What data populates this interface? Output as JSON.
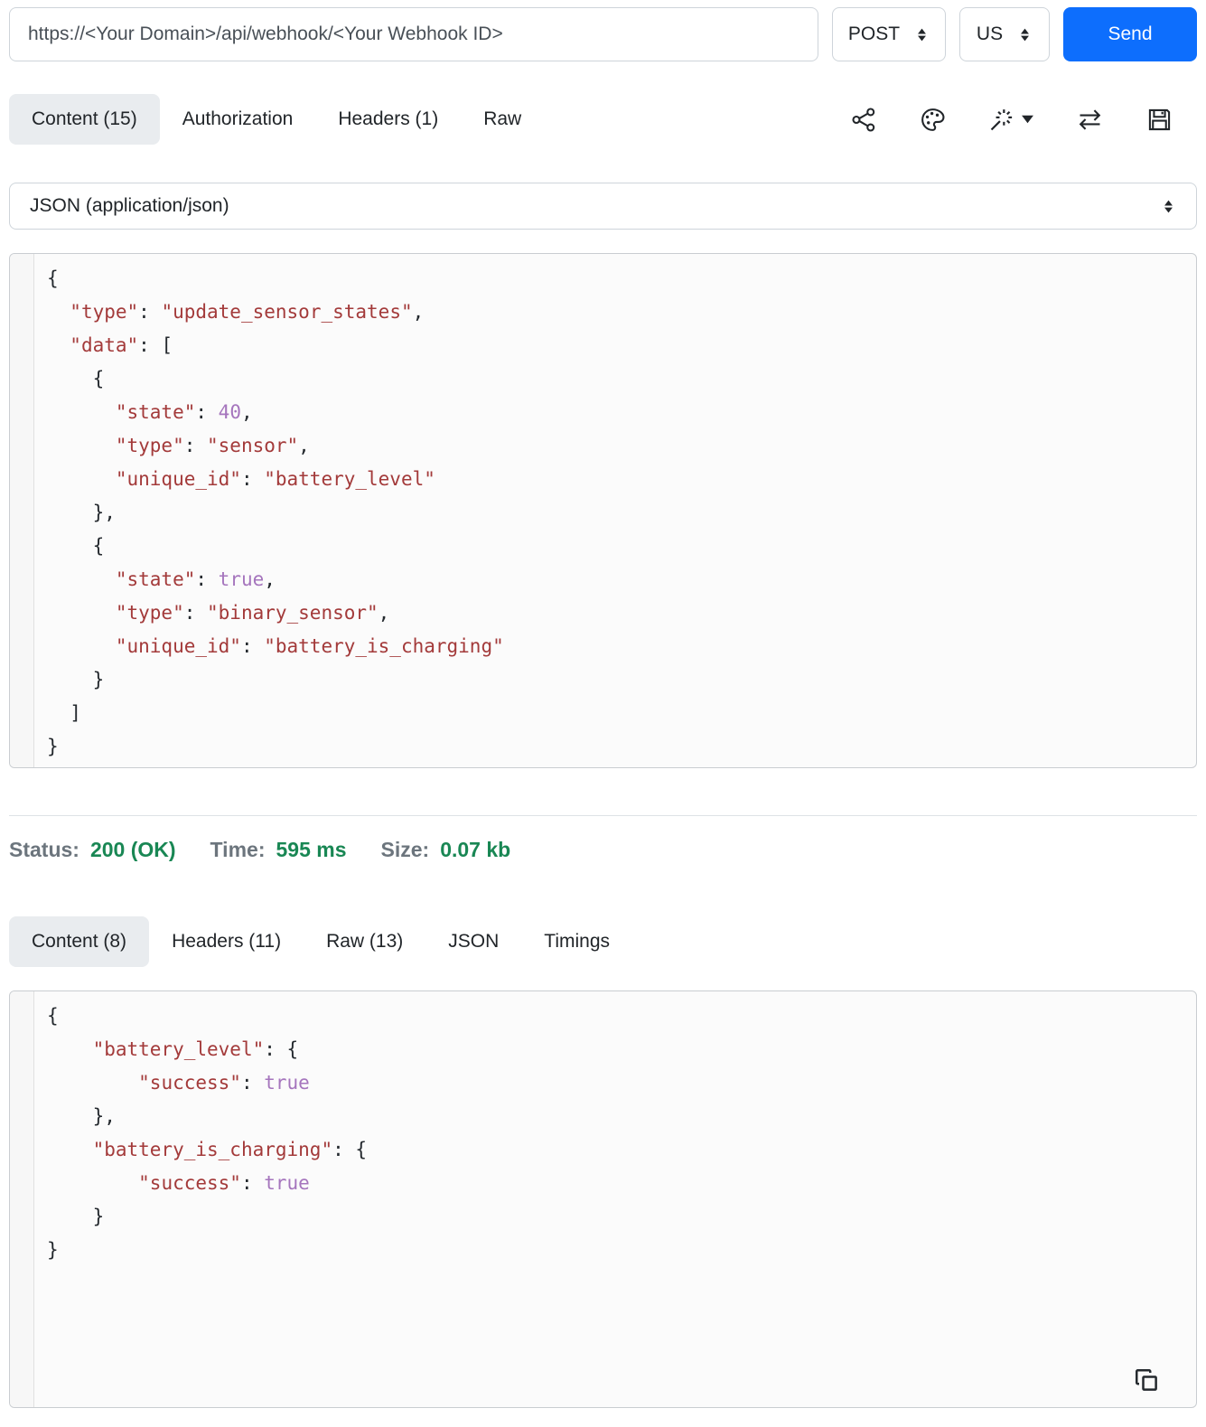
{
  "request_bar": {
    "url": "https://<Your Domain>/api/webhook/<Your Webhook ID>",
    "method": "POST",
    "region": "US",
    "send_label": "Send"
  },
  "request_tabs": [
    {
      "id": "content",
      "label": "Content (15)",
      "active": true
    },
    {
      "id": "authorization",
      "label": "Authorization",
      "active": false
    },
    {
      "id": "headers",
      "label": "Headers (1)",
      "active": false
    },
    {
      "id": "raw",
      "label": "Raw",
      "active": false
    }
  ],
  "toolbar_icons": [
    {
      "name": "share-icon"
    },
    {
      "name": "palette-icon"
    },
    {
      "name": "magic-wand-icon",
      "has_dropdown": true
    },
    {
      "name": "swap-horizontal-icon"
    },
    {
      "name": "save-icon"
    }
  ],
  "content_type": {
    "selected": "JSON (application/json)"
  },
  "request_body": {
    "lines": [
      [
        [
          "p",
          "{"
        ]
      ],
      [
        [
          "p",
          "  "
        ],
        [
          "str",
          "\"type\""
        ],
        [
          "p",
          ": "
        ],
        [
          "str",
          "\"update_sensor_states\""
        ],
        [
          "p",
          ","
        ]
      ],
      [
        [
          "p",
          "  "
        ],
        [
          "str",
          "\"data\""
        ],
        [
          "p",
          ": ["
        ]
      ],
      [
        [
          "p",
          "    {"
        ]
      ],
      [
        [
          "p",
          "      "
        ],
        [
          "str",
          "\"state\""
        ],
        [
          "p",
          ": "
        ],
        [
          "lit",
          "40"
        ],
        [
          "p",
          ","
        ]
      ],
      [
        [
          "p",
          "      "
        ],
        [
          "str",
          "\"type\""
        ],
        [
          "p",
          ": "
        ],
        [
          "str",
          "\"sensor\""
        ],
        [
          "p",
          ","
        ]
      ],
      [
        [
          "p",
          "      "
        ],
        [
          "str",
          "\"unique_id\""
        ],
        [
          "p",
          ": "
        ],
        [
          "str",
          "\"battery_level\""
        ]
      ],
      [
        [
          "p",
          "    },"
        ]
      ],
      [
        [
          "p",
          "    {"
        ]
      ],
      [
        [
          "p",
          "      "
        ],
        [
          "str",
          "\"state\""
        ],
        [
          "p",
          ": "
        ],
        [
          "lit",
          "true"
        ],
        [
          "p",
          ","
        ]
      ],
      [
        [
          "p",
          "      "
        ],
        [
          "str",
          "\"type\""
        ],
        [
          "p",
          ": "
        ],
        [
          "str",
          "\"binary_sensor\""
        ],
        [
          "p",
          ","
        ]
      ],
      [
        [
          "p",
          "      "
        ],
        [
          "str",
          "\"unique_id\""
        ],
        [
          "p",
          ": "
        ],
        [
          "str",
          "\"battery_is_charging\""
        ]
      ],
      [
        [
          "p",
          "    }"
        ]
      ],
      [
        [
          "p",
          "  ]"
        ]
      ],
      [
        [
          "p",
          "}"
        ]
      ]
    ]
  },
  "status_bar": {
    "status_label": "Status:",
    "status_value": "200 (OK)",
    "time_label": "Time:",
    "time_value": "595 ms",
    "size_label": "Size:",
    "size_value": "0.07 kb"
  },
  "response_tabs": [
    {
      "id": "content",
      "label": "Content (8)",
      "active": true
    },
    {
      "id": "headers",
      "label": "Headers (11)",
      "active": false
    },
    {
      "id": "raw",
      "label": "Raw (13)",
      "active": false
    },
    {
      "id": "json",
      "label": "JSON",
      "active": false
    },
    {
      "id": "timings",
      "label": "Timings",
      "active": false
    }
  ],
  "response_body": {
    "lines": [
      [
        [
          "p",
          "{"
        ]
      ],
      [
        [
          "p",
          "    "
        ],
        [
          "str",
          "\"battery_level\""
        ],
        [
          "p",
          ": {"
        ]
      ],
      [
        [
          "p",
          "        "
        ],
        [
          "str",
          "\"success\""
        ],
        [
          "p",
          ": "
        ],
        [
          "lit",
          "true"
        ]
      ],
      [
        [
          "p",
          "    },"
        ]
      ],
      [
        [
          "p",
          "    "
        ],
        [
          "str",
          "\"battery_is_charging\""
        ],
        [
          "p",
          ": {"
        ]
      ],
      [
        [
          "p",
          "        "
        ],
        [
          "str",
          "\"success\""
        ],
        [
          "p",
          ": "
        ],
        [
          "lit",
          "true"
        ]
      ],
      [
        [
          "p",
          "    }"
        ]
      ],
      [
        [
          "p",
          "}"
        ]
      ]
    ]
  },
  "colors": {
    "accent_blue": "#0d6efd",
    "success_green": "#198754",
    "muted_label": "#6c757d",
    "active_tab_bg": "#e9ecef",
    "code_string": "#a33a3a",
    "code_literal": "#a575bd",
    "code_punctuation": "#24292e",
    "code_bg": "#fbfbfb"
  }
}
